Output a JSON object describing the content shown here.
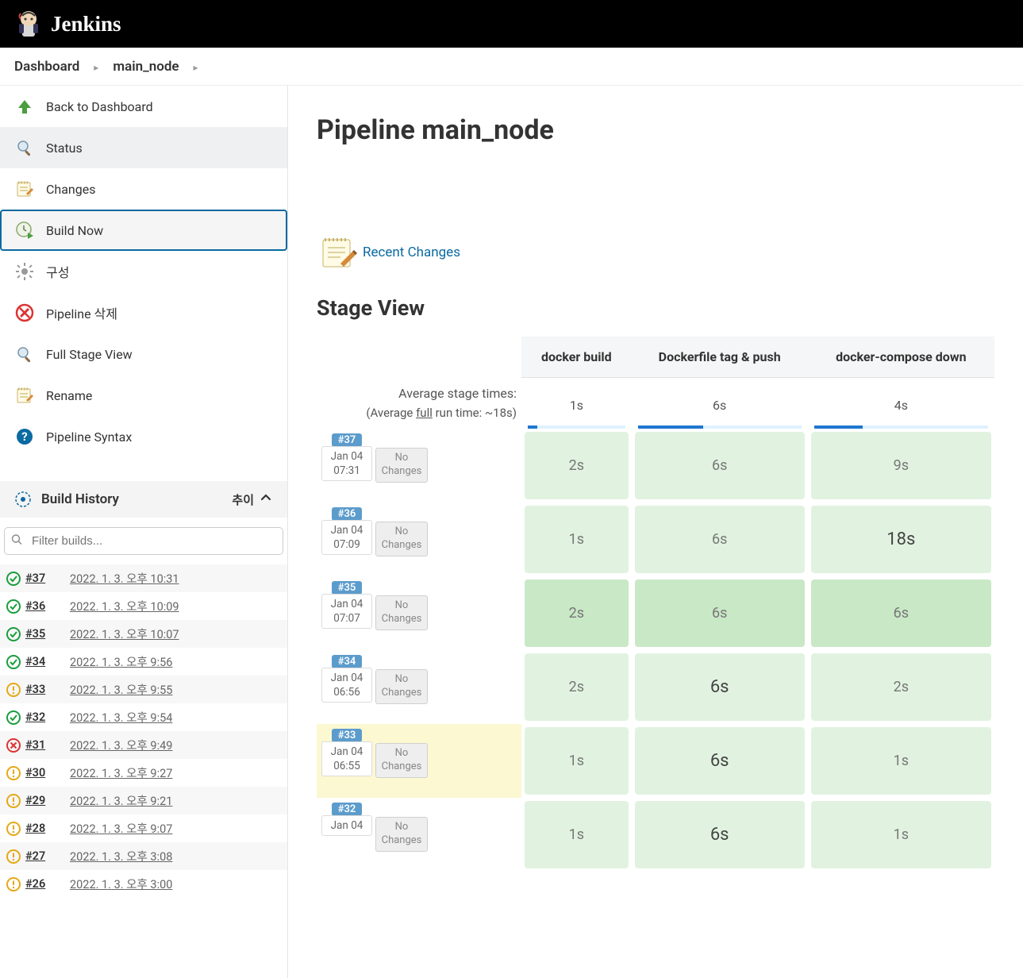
{
  "header": {
    "title": "Jenkins"
  },
  "breadcrumb": {
    "items": [
      "Dashboard",
      "main_node"
    ]
  },
  "sidebar": {
    "nav": [
      {
        "label": "Back to Dashboard",
        "icon": "up-arrow",
        "kind": "back"
      },
      {
        "label": "Status",
        "icon": "magnify",
        "kind": "status",
        "active": true
      },
      {
        "label": "Changes",
        "icon": "notepad",
        "kind": "changes"
      },
      {
        "label": "Build Now",
        "icon": "clock-play",
        "kind": "build-now",
        "highlight": true
      },
      {
        "label": "구성",
        "icon": "gear",
        "kind": "configure"
      },
      {
        "label": "Pipeline 삭제",
        "icon": "delete",
        "kind": "delete"
      },
      {
        "label": "Full Stage View",
        "icon": "magnify",
        "kind": "full-stage"
      },
      {
        "label": "Rename",
        "icon": "notepad",
        "kind": "rename"
      },
      {
        "label": "Pipeline Syntax",
        "icon": "help",
        "kind": "syntax"
      }
    ],
    "build_history": {
      "title": "Build History",
      "trend_label": "추이",
      "filter_placeholder": "Filter builds...",
      "builds": [
        {
          "num": "#37",
          "date": "2022. 1. 3. 오후 10:31",
          "status": "success"
        },
        {
          "num": "#36",
          "date": "2022. 1. 3. 오후 10:09",
          "status": "success"
        },
        {
          "num": "#35",
          "date": "2022. 1. 3. 오후 10:07",
          "status": "success"
        },
        {
          "num": "#34",
          "date": "2022. 1. 3. 오후 9:56",
          "status": "success"
        },
        {
          "num": "#33",
          "date": "2022. 1. 3. 오후 9:55",
          "status": "unstable"
        },
        {
          "num": "#32",
          "date": "2022. 1. 3. 오후 9:54",
          "status": "success"
        },
        {
          "num": "#31",
          "date": "2022. 1. 3. 오후 9:49",
          "status": "failed"
        },
        {
          "num": "#30",
          "date": "2022. 1. 3. 오후 9:27",
          "status": "unstable"
        },
        {
          "num": "#29",
          "date": "2022. 1. 3. 오후 9:21",
          "status": "unstable"
        },
        {
          "num": "#28",
          "date": "2022. 1. 3. 오후 9:07",
          "status": "unstable"
        },
        {
          "num": "#27",
          "date": "2022. 1. 3. 오후 3:08",
          "status": "unstable"
        },
        {
          "num": "#26",
          "date": "2022. 1. 3. 오후 3:00",
          "status": "unstable"
        }
      ]
    }
  },
  "main": {
    "page_title": "Pipeline main_node",
    "recent_changes_label": "Recent Changes",
    "stage_view_title": "Stage View",
    "stage_columns": [
      "docker build",
      "Dockerfile tag & push",
      "docker-compose down"
    ],
    "avg": {
      "label": "Average stage times:",
      "sublabel_pre": "(Average ",
      "sublabel_mid": "full",
      "sublabel_post": " run time: ~18s)",
      "times": [
        "1s",
        "6s",
        "4s"
      ],
      "bar_pct": [
        10,
        40,
        28
      ]
    },
    "no_changes_label": "No Changes",
    "rows": [
      {
        "id": "#37",
        "date": "Jan 04",
        "time": "07:31",
        "cells": [
          "2s",
          "6s",
          "9s"
        ]
      },
      {
        "id": "#36",
        "date": "Jan 04",
        "time": "07:09",
        "cells": [
          "1s",
          "6s",
          "18s"
        ],
        "big": [
          false,
          false,
          true
        ]
      },
      {
        "id": "#35",
        "date": "Jan 04",
        "time": "07:07",
        "cells": [
          "2s",
          "6s",
          "6s"
        ],
        "hover": true
      },
      {
        "id": "#34",
        "date": "Jan 04",
        "time": "06:56",
        "cells": [
          "2s",
          "6s",
          "2s"
        ],
        "big": [
          false,
          true,
          false
        ]
      },
      {
        "id": "#33",
        "date": "Jan 04",
        "time": "06:55",
        "cells": [
          "1s",
          "6s",
          "1s"
        ],
        "big": [
          false,
          true,
          false
        ],
        "warn": true
      },
      {
        "id": "#32",
        "date": "Jan 04",
        "time": "",
        "cells": [
          "1s",
          "6s",
          "1s"
        ],
        "big": [
          false,
          true,
          false
        ]
      }
    ]
  }
}
